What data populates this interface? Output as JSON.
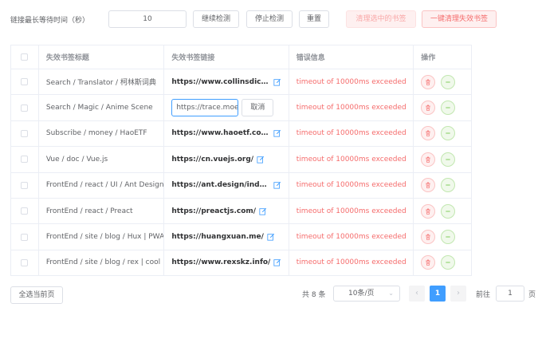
{
  "toolbar": {
    "timeout_label": "链接最长等待时间（秒）",
    "timeout_value": "10",
    "continue_button": "继续检测",
    "stop_button": "停止检测",
    "reset_button": "重置",
    "clean_selected_button": "清理选中的书签",
    "clean_all_button": "一键清理失效书签"
  },
  "table": {
    "headers": [
      "失效书签标题",
      "失效书签链接",
      "错误信息",
      "操作"
    ],
    "rows": [
      {
        "title": "Search / Translator / 柯林斯词典",
        "link": "https://www.collinsdictionary.com/",
        "error": "timeout of 10000ms exceeded"
      },
      {
        "title": "Search / Magic / Anime Scene",
        "link": "https://trace.moe/",
        "error": "timeout of 10000ms exceeded",
        "editing": true,
        "edit_value": "https://trace.moe.",
        "cancel_label": "取消"
      },
      {
        "title": "Subscribe / money / HaoETF",
        "link": "https://www.haoetf.com/",
        "error": "timeout of 10000ms exceeded"
      },
      {
        "title": "Vue / doc / Vue.js",
        "link": "https://cn.vuejs.org/",
        "error": "timeout of 10000ms exceeded"
      },
      {
        "title": "FrontEnd / react / UI / Ant Design",
        "link": "https://ant.design/index-cn",
        "error": "timeout of 10000ms exceeded"
      },
      {
        "title": "FrontEnd / react / Preact",
        "link": "https://preactjs.com/",
        "error": "timeout of 10000ms exceeded"
      },
      {
        "title": "FrontEnd / site / blog / Hux | PWA",
        "link": "https://huangxuan.me/",
        "error": "timeout of 10000ms exceeded"
      },
      {
        "title": "FrontEnd / site / blog / rex | cool",
        "link": "https://www.rexskz.info/",
        "error": "timeout of 10000ms exceeded"
      }
    ]
  },
  "footer": {
    "select_page_button": "全选当前页",
    "total": "共 8 条",
    "page_size": "10条/页",
    "current_page": "1",
    "goto_label": "前往",
    "goto_value": "1",
    "page_suffix": "页"
  },
  "colors": {
    "primary": "#409eff",
    "danger": "#f56c6c",
    "success": "#67c23a"
  },
  "icons": [
    "edit-icon",
    "delete-icon",
    "minus-icon",
    "chevron-left-icon",
    "chevron-right-icon",
    "chevron-down-icon"
  ]
}
